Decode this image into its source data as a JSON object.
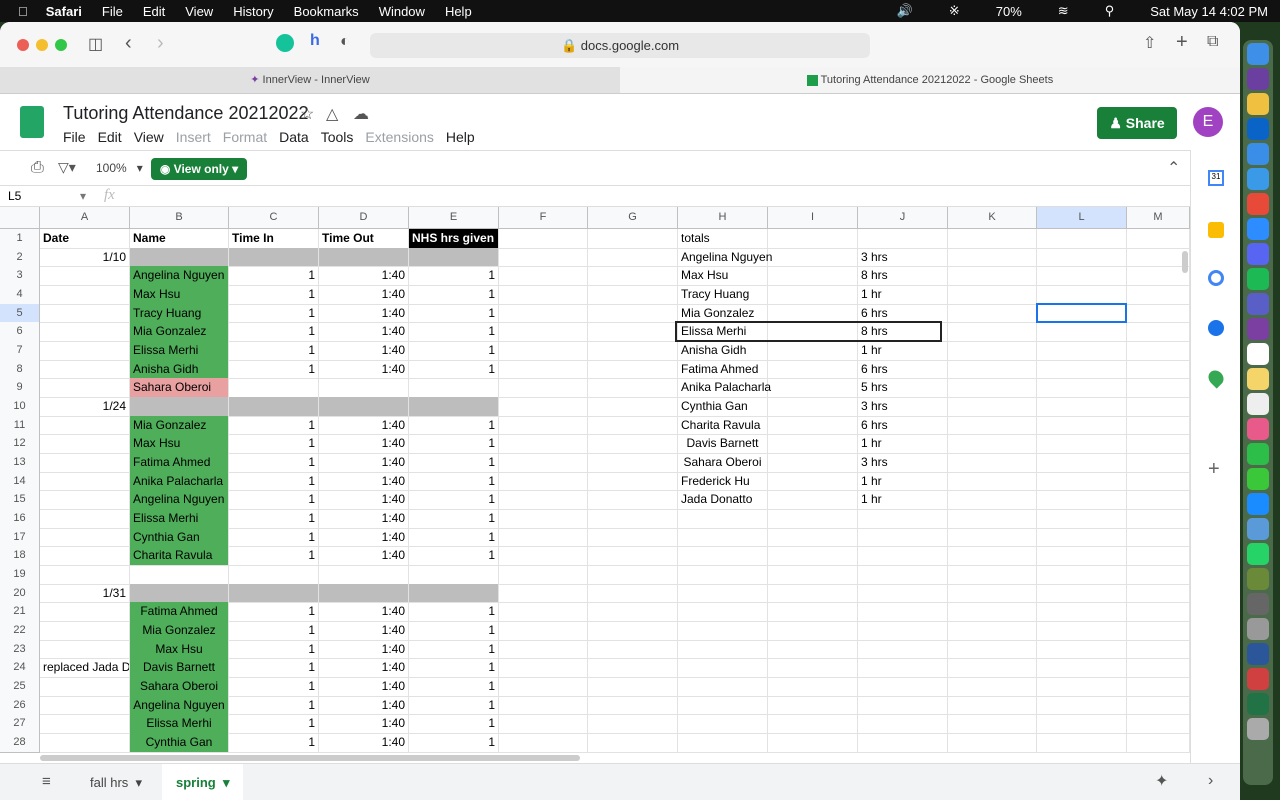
{
  "menubar": {
    "app": "Safari",
    "items": [
      "File",
      "Edit",
      "View",
      "History",
      "Bookmarks",
      "Window",
      "Help"
    ],
    "battery": "70%",
    "clock": "Sat May 14  4:02 PM"
  },
  "browser": {
    "url": "docs.google.com",
    "tabs": [
      "InnerView - InnerView",
      "Tutoring Attendance 20212022 - Google Sheets"
    ]
  },
  "doc": {
    "title": "Tutoring Attendance 20212022",
    "menus": [
      {
        "l": "File",
        "d": false
      },
      {
        "l": "Edit",
        "d": false
      },
      {
        "l": "View",
        "d": false
      },
      {
        "l": "Insert",
        "d": true
      },
      {
        "l": "Format",
        "d": true
      },
      {
        "l": "Data",
        "d": false
      },
      {
        "l": "Tools",
        "d": false
      },
      {
        "l": "Extensions",
        "d": true
      },
      {
        "l": "Help",
        "d": false
      }
    ],
    "share": "Share",
    "avatar": "E"
  },
  "toolbar": {
    "zoom": "100%",
    "view_only": "View only"
  },
  "formula": {
    "cell_ref": "L5",
    "fx": "fx"
  },
  "columns": [
    "A",
    "B",
    "C",
    "D",
    "E",
    "F",
    "G",
    "H",
    "I",
    "J",
    "K",
    "L",
    "M"
  ],
  "selected_cell": "L5",
  "fills": {
    "green": "#4fae5a",
    "gray": "#bdbdbd",
    "red": "#e8a0a0",
    "black": "#000000"
  },
  "rows": [
    {
      "n": 1,
      "cells": [
        [
          "A",
          "Date",
          "",
          "b"
        ],
        [
          "B",
          "Name",
          "",
          "b"
        ],
        [
          "C",
          "Time In",
          "",
          "b"
        ],
        [
          "D",
          "Time Out",
          "",
          "b"
        ],
        [
          "E",
          "NHS hrs given",
          "black",
          "b"
        ],
        [
          "H",
          "totals"
        ]
      ]
    },
    {
      "n": 2,
      "cells": [
        [
          "A",
          "1/10",
          "",
          "r"
        ],
        [
          "B",
          "",
          "gray"
        ],
        [
          "C",
          "",
          "gray"
        ],
        [
          "D",
          "",
          "gray"
        ],
        [
          "E",
          "",
          "gray"
        ],
        [
          "H",
          "Angelina Nguyen"
        ],
        [
          "J",
          "3 hrs"
        ]
      ]
    },
    {
      "n": 3,
      "cells": [
        [
          "B",
          "Angelina Nguyen",
          "green"
        ],
        [
          "C",
          "1",
          "",
          "r"
        ],
        [
          "D",
          "1:40",
          "",
          "r"
        ],
        [
          "E",
          "1",
          "",
          "r"
        ],
        [
          "H",
          "Max Hsu"
        ],
        [
          "J",
          "8 hrs"
        ]
      ]
    },
    {
      "n": 4,
      "cells": [
        [
          "B",
          "Max Hsu",
          "green"
        ],
        [
          "C",
          "1",
          "",
          "r"
        ],
        [
          "D",
          "1:40",
          "",
          "r"
        ],
        [
          "E",
          "1",
          "",
          "r"
        ],
        [
          "H",
          "Tracy Huang"
        ],
        [
          "J",
          "1 hr"
        ]
      ]
    },
    {
      "n": 5,
      "cells": [
        [
          "B",
          "Tracy Huang",
          "green"
        ],
        [
          "C",
          "1",
          "",
          "r"
        ],
        [
          "D",
          "1:40",
          "",
          "r"
        ],
        [
          "E",
          "1",
          "",
          "r"
        ],
        [
          "H",
          "Mia Gonzalez"
        ],
        [
          "J",
          "6 hrs"
        ]
      ]
    },
    {
      "n": 6,
      "cells": [
        [
          "B",
          "Mia Gonzalez",
          "green"
        ],
        [
          "C",
          "1",
          "",
          "r"
        ],
        [
          "D",
          "1:40",
          "",
          "r"
        ],
        [
          "E",
          "1",
          "",
          "r"
        ],
        [
          "H",
          "Elissa Merhi"
        ],
        [
          "J",
          "8 hrs"
        ]
      ]
    },
    {
      "n": 7,
      "cells": [
        [
          "B",
          "Elissa Merhi",
          "green"
        ],
        [
          "C",
          "1",
          "",
          "r"
        ],
        [
          "D",
          "1:40",
          "",
          "r"
        ],
        [
          "E",
          "1",
          "",
          "r"
        ],
        [
          "H",
          "Anisha Gidh"
        ],
        [
          "J",
          "1 hr"
        ]
      ]
    },
    {
      "n": 8,
      "cells": [
        [
          "B",
          "Anisha Gidh",
          "green"
        ],
        [
          "C",
          "1",
          "",
          "r"
        ],
        [
          "D",
          "1:40",
          "",
          "r"
        ],
        [
          "E",
          "1",
          "",
          "r"
        ],
        [
          "H",
          "Fatima Ahmed"
        ],
        [
          "J",
          "6 hrs"
        ]
      ]
    },
    {
      "n": 9,
      "cells": [
        [
          "B",
          "Sahara Oberoi",
          "red"
        ],
        [
          "H",
          "Anika Palacharla"
        ],
        [
          "J",
          "5 hrs"
        ]
      ]
    },
    {
      "n": 10,
      "cells": [
        [
          "A",
          "1/24",
          "",
          "r"
        ],
        [
          "B",
          "",
          "gray"
        ],
        [
          "C",
          "",
          "gray"
        ],
        [
          "D",
          "",
          "gray"
        ],
        [
          "E",
          "",
          "gray"
        ],
        [
          "H",
          "Cynthia Gan"
        ],
        [
          "J",
          "3 hrs"
        ]
      ]
    },
    {
      "n": 11,
      "cells": [
        [
          "B",
          "Mia Gonzalez",
          "green"
        ],
        [
          "C",
          "1",
          "",
          "r"
        ],
        [
          "D",
          "1:40",
          "",
          "r"
        ],
        [
          "E",
          "1",
          "",
          "r"
        ],
        [
          "H",
          "Charita Ravula"
        ],
        [
          "J",
          "6 hrs"
        ]
      ]
    },
    {
      "n": 12,
      "cells": [
        [
          "B",
          "Max Hsu",
          "green"
        ],
        [
          "C",
          "1",
          "",
          "r"
        ],
        [
          "D",
          "1:40",
          "",
          "r"
        ],
        [
          "E",
          "1",
          "",
          "r"
        ],
        [
          "H",
          "Davis Barnett",
          "",
          "c"
        ],
        [
          "J",
          "1 hr"
        ]
      ]
    },
    {
      "n": 13,
      "cells": [
        [
          "B",
          "Fatima Ahmed",
          "green"
        ],
        [
          "C",
          "1",
          "",
          "r"
        ],
        [
          "D",
          "1:40",
          "",
          "r"
        ],
        [
          "E",
          "1",
          "",
          "r"
        ],
        [
          "H",
          "Sahara Oberoi",
          "",
          "c"
        ],
        [
          "J",
          "3 hrs"
        ]
      ]
    },
    {
      "n": 14,
      "cells": [
        [
          "B",
          "Anika Palacharla",
          "green"
        ],
        [
          "C",
          "1",
          "",
          "r"
        ],
        [
          "D",
          "1:40",
          "",
          "r"
        ],
        [
          "E",
          "1",
          "",
          "r"
        ],
        [
          "H",
          "Frederick Hu"
        ],
        [
          "J",
          "1 hr"
        ]
      ]
    },
    {
      "n": 15,
      "cells": [
        [
          "B",
          "Angelina Nguyen",
          "green"
        ],
        [
          "C",
          "1",
          "",
          "r"
        ],
        [
          "D",
          "1:40",
          "",
          "r"
        ],
        [
          "E",
          "1",
          "",
          "r"
        ],
        [
          "H",
          "Jada Donatto"
        ],
        [
          "J",
          "1 hr"
        ]
      ]
    },
    {
      "n": 16,
      "cells": [
        [
          "B",
          "Elissa Merhi",
          "green"
        ],
        [
          "C",
          "1",
          "",
          "r"
        ],
        [
          "D",
          "1:40",
          "",
          "r"
        ],
        [
          "E",
          "1",
          "",
          "r"
        ]
      ]
    },
    {
      "n": 17,
      "cells": [
        [
          "B",
          "Cynthia Gan",
          "green"
        ],
        [
          "C",
          "1",
          "",
          "r"
        ],
        [
          "D",
          "1:40",
          "",
          "r"
        ],
        [
          "E",
          "1",
          "",
          "r"
        ]
      ]
    },
    {
      "n": 18,
      "cells": [
        [
          "B",
          "Charita Ravula",
          "green"
        ],
        [
          "C",
          "1",
          "",
          "r"
        ],
        [
          "D",
          "1:40",
          "",
          "r"
        ],
        [
          "E",
          "1",
          "",
          "r"
        ]
      ]
    },
    {
      "n": 19,
      "cells": []
    },
    {
      "n": 20,
      "cells": [
        [
          "A",
          "1/31",
          "",
          "r"
        ],
        [
          "B",
          "",
          "gray"
        ],
        [
          "C",
          "",
          "gray"
        ],
        [
          "D",
          "",
          "gray"
        ],
        [
          "E",
          "",
          "gray"
        ]
      ]
    },
    {
      "n": 21,
      "cells": [
        [
          "B",
          "Fatima Ahmed",
          "green",
          "c"
        ],
        [
          "C",
          "1",
          "",
          "r"
        ],
        [
          "D",
          "1:40",
          "",
          "r"
        ],
        [
          "E",
          "1",
          "",
          "r"
        ]
      ]
    },
    {
      "n": 22,
      "cells": [
        [
          "B",
          "Mia Gonzalez",
          "green",
          "c"
        ],
        [
          "C",
          "1",
          "",
          "r"
        ],
        [
          "D",
          "1:40",
          "",
          "r"
        ],
        [
          "E",
          "1",
          "",
          "r"
        ]
      ]
    },
    {
      "n": 23,
      "cells": [
        [
          "B",
          "Max Hsu",
          "green",
          "c"
        ],
        [
          "C",
          "1",
          "",
          "r"
        ],
        [
          "D",
          "1:40",
          "",
          "r"
        ],
        [
          "E",
          "1",
          "",
          "r"
        ]
      ]
    },
    {
      "n": 24,
      "cells": [
        [
          "A",
          "replaced Jada Do",
          "",
          "clip"
        ],
        [
          "B",
          "Davis Barnett",
          "green",
          "c"
        ],
        [
          "C",
          "1",
          "",
          "r"
        ],
        [
          "D",
          "1:40",
          "",
          "r"
        ],
        [
          "E",
          "1",
          "",
          "r"
        ]
      ]
    },
    {
      "n": 25,
      "cells": [
        [
          "B",
          "Sahara Oberoi",
          "green",
          "c"
        ],
        [
          "C",
          "1",
          "",
          "r"
        ],
        [
          "D",
          "1:40",
          "",
          "r"
        ],
        [
          "E",
          "1",
          "",
          "r"
        ]
      ]
    },
    {
      "n": 26,
      "cells": [
        [
          "B",
          "Angelina Nguyen",
          "green",
          "c"
        ],
        [
          "C",
          "1",
          "",
          "r"
        ],
        [
          "D",
          "1:40",
          "",
          "r"
        ],
        [
          "E",
          "1",
          "",
          "r"
        ]
      ]
    },
    {
      "n": 27,
      "cells": [
        [
          "B",
          "Elissa Merhi",
          "green",
          "c"
        ],
        [
          "C",
          "1",
          "",
          "r"
        ],
        [
          "D",
          "1:40",
          "",
          "r"
        ],
        [
          "E",
          "1",
          "",
          "r"
        ]
      ]
    },
    {
      "n": 28,
      "cells": [
        [
          "B",
          "Cynthia Gan",
          "green",
          "c"
        ],
        [
          "C",
          "1",
          "",
          "r"
        ],
        [
          "D",
          "1:40",
          "",
          "r"
        ],
        [
          "E",
          "1",
          "",
          "r"
        ]
      ]
    }
  ],
  "sheets": [
    {
      "name": "fall hrs",
      "active": false
    },
    {
      "name": "spring",
      "active": true
    }
  ]
}
